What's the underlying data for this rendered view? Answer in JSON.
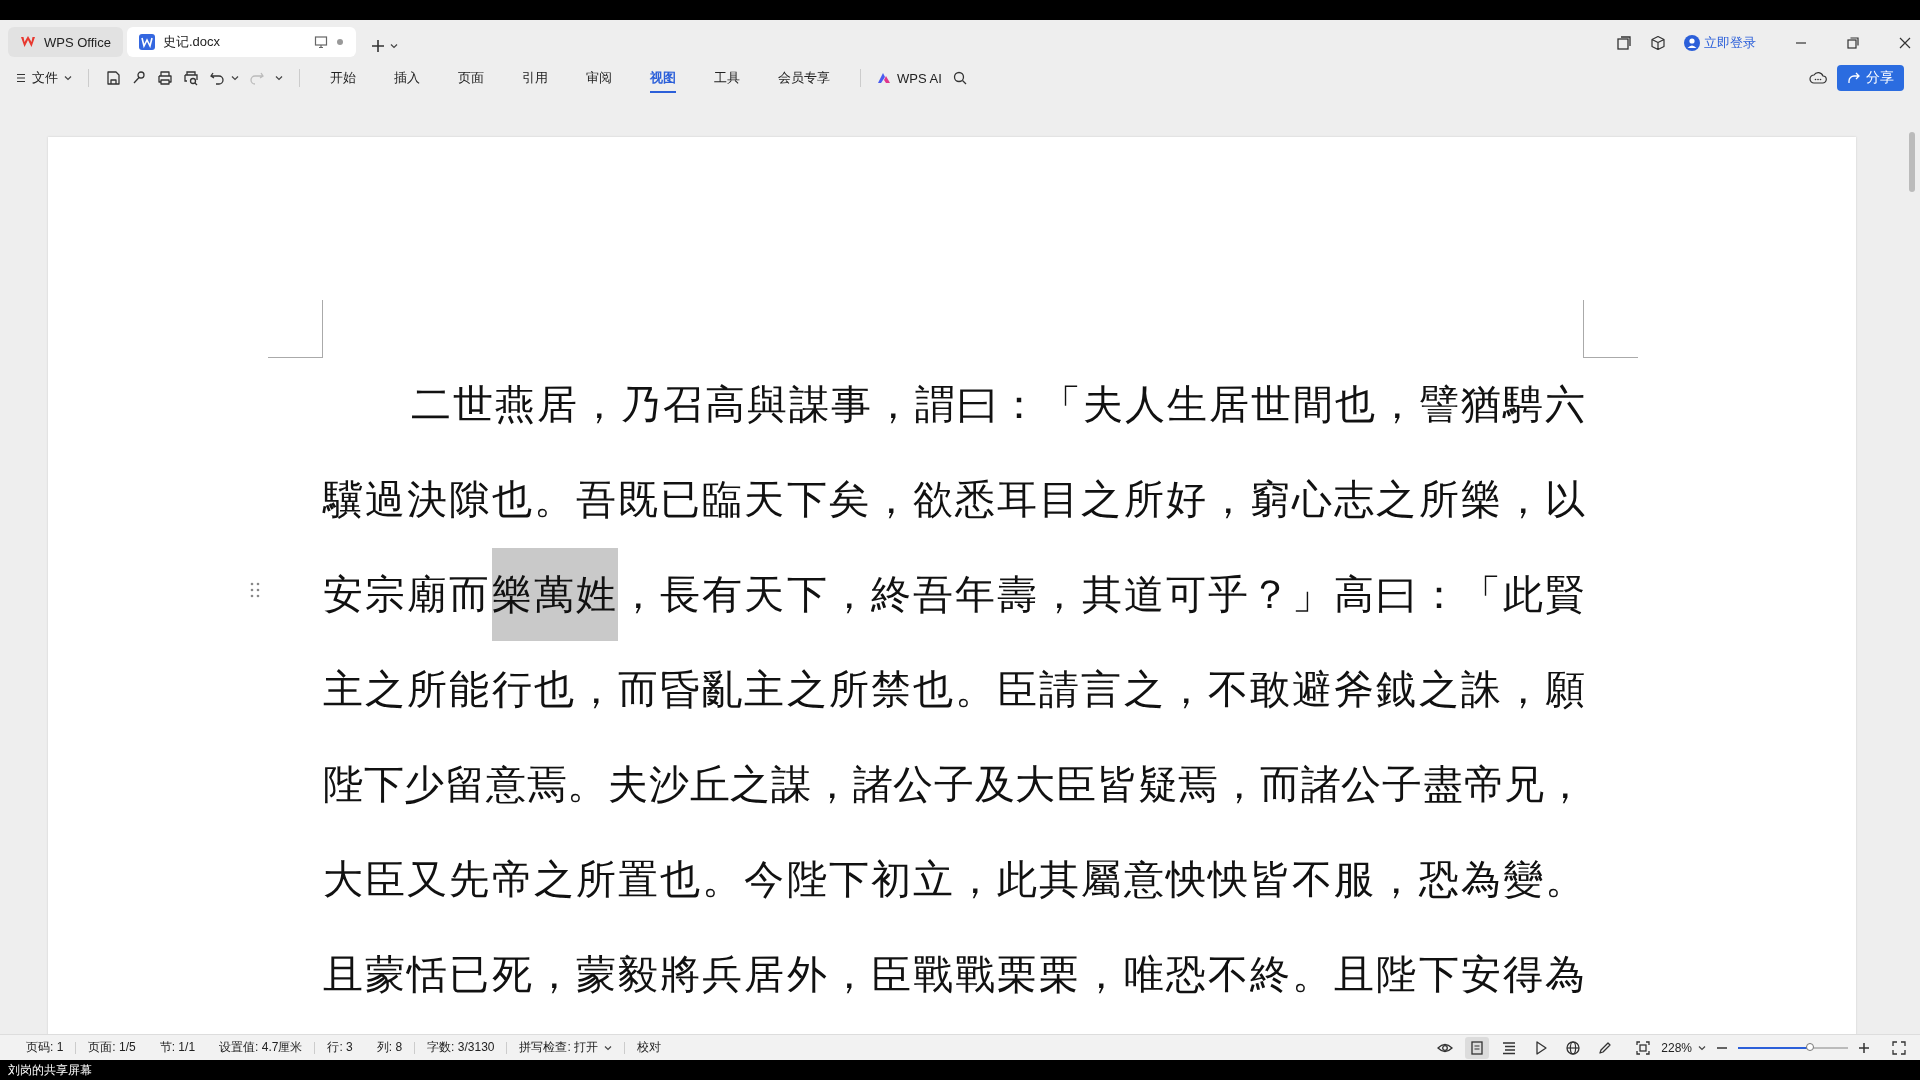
{
  "titlebar": {
    "tabs": [
      {
        "label": "WPS Office",
        "kind": "home",
        "selected": false
      },
      {
        "label": "史记.docx",
        "kind": "document",
        "selected": true
      }
    ],
    "login": "立即登录"
  },
  "toolbar": {
    "file_menu": "文件",
    "ribbon_tabs": [
      {
        "label": "开始",
        "selected": false
      },
      {
        "label": "插入",
        "selected": false
      },
      {
        "label": "页面",
        "selected": false
      },
      {
        "label": "引用",
        "selected": false
      },
      {
        "label": "审阅",
        "selected": false
      },
      {
        "label": "视图",
        "selected": true
      },
      {
        "label": "工具",
        "selected": false
      },
      {
        "label": "会员专享",
        "selected": false
      }
    ],
    "ai_label": "WPS AI",
    "share": "分享"
  },
  "document": {
    "lines": [
      {
        "indent": true,
        "segments": [
          {
            "text": "二世燕居，乃召高與謀事，謂曰：「夫人生居世間也，譬猶騁六",
            "selected": false
          }
        ]
      },
      {
        "indent": false,
        "segments": [
          {
            "text": "驥過決隙也。吾既已臨天下矣，欲悉耳目之所好，窮心志之所樂，以",
            "selected": false
          }
        ]
      },
      {
        "indent": false,
        "segments": [
          {
            "text": "安宗廟而",
            "selected": false
          },
          {
            "text": "樂萬姓",
            "selected": true
          },
          {
            "text": "，長有天下，終吾年壽，其道可乎？」高曰：「此賢",
            "selected": false
          }
        ]
      },
      {
        "indent": false,
        "segments": [
          {
            "text": "主之所能行也，而昏亂主之所禁也。臣請言之，不敢避斧鉞之誅，願",
            "selected": false
          }
        ]
      },
      {
        "indent": false,
        "segments": [
          {
            "text": "陛下少留意焉。夫沙丘之謀，諸公子及大臣皆疑焉，而諸公子盡帝兄，",
            "selected": false
          }
        ]
      },
      {
        "indent": false,
        "segments": [
          {
            "text": "大臣又先帝之所置也。今陛下初立，此其屬意怏怏皆不服，恐為變。",
            "selected": false
          }
        ]
      },
      {
        "indent": false,
        "segments": [
          {
            "text": "且蒙恬已死，蒙毅將兵居外，臣戰戰栗栗，唯恐不終。且陛下安得為",
            "selected": false
          }
        ]
      }
    ]
  },
  "status_bar": {
    "items": [
      "页码: 1",
      "页面: 1/5",
      "节: 1/1",
      "设置值: 4.7厘米",
      "行: 3",
      "列: 8",
      "字数: 3/3130"
    ],
    "spell_check": "拼写检查: 打开",
    "proofread": "校对",
    "views": [
      {
        "kind": "read",
        "selected": false
      },
      {
        "kind": "page",
        "selected": true
      },
      {
        "kind": "outline",
        "selected": false
      },
      {
        "kind": "play",
        "selected": false
      },
      {
        "kind": "web",
        "selected": false
      },
      {
        "kind": "pen",
        "selected": false
      }
    ],
    "zoom": "228%",
    "zoom_slider": {
      "level": 0.65
    }
  },
  "share_banner": "刘岗的共享屏幕"
}
